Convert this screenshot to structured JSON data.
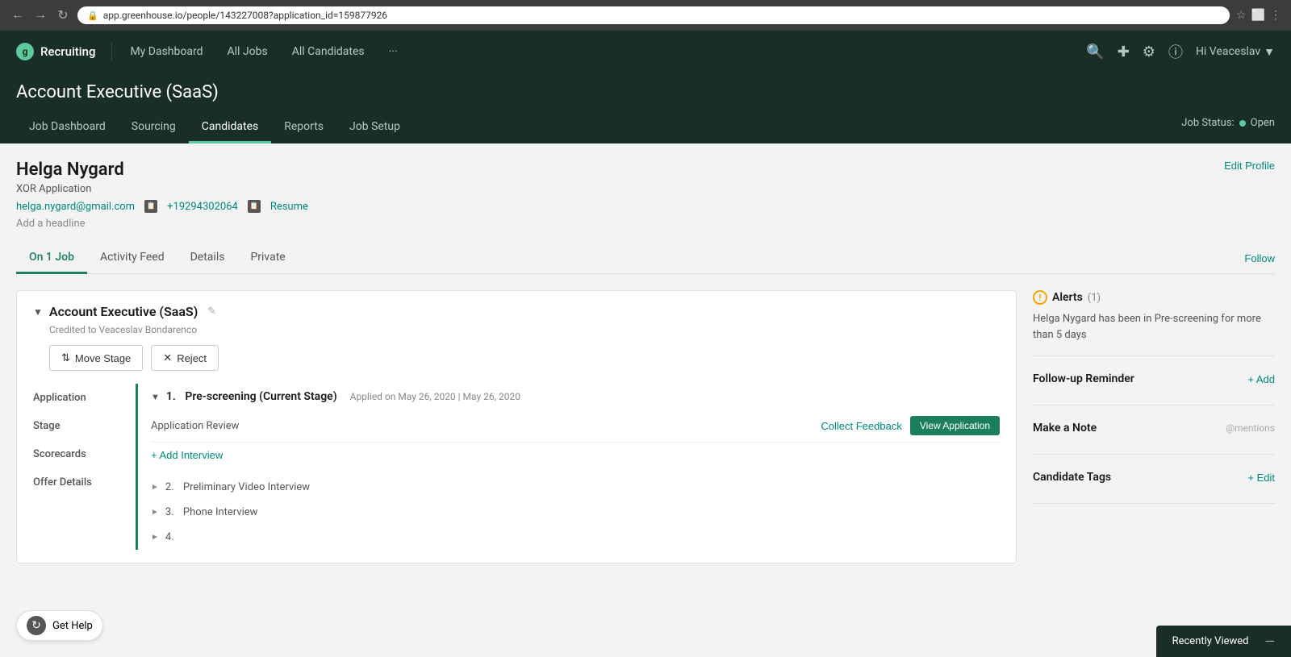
{
  "browser": {
    "url": "app.greenhouse.io/people/143227008?application_id=159877926",
    "back_title": "Back",
    "forward_title": "Forward",
    "refresh_title": "Refresh"
  },
  "app_nav": {
    "logo_text": "g",
    "app_name": "Recruiting",
    "links": [
      "My Dashboard",
      "All Jobs",
      "All Candidates",
      "···"
    ],
    "user_greeting": "Hi Veaceslav",
    "search_icon": "search",
    "add_icon": "plus",
    "settings_icon": "gear",
    "help_icon": "question"
  },
  "job_header": {
    "title": "Account Executive (SaaS)",
    "tabs": [
      "Job Dashboard",
      "Sourcing",
      "Candidates",
      "Reports",
      "Job Setup"
    ],
    "active_tab": "Candidates",
    "status_label": "Job Status:",
    "status_value": "Open"
  },
  "candidate": {
    "name": "Helga Nygard",
    "app_type": "XOR Application",
    "email": "helga.nygard@gmail.com",
    "phone": "+19294302064",
    "resume_label": "Resume",
    "add_headline": "Add a headline",
    "edit_profile_label": "Edit Profile",
    "tabs": [
      "On 1 Job",
      "Activity Feed",
      "Details",
      "Private"
    ],
    "active_tab": "On 1 Job",
    "follow_label": "Follow"
  },
  "application": {
    "job_title": "Account Executive (SaaS)",
    "credited_to": "Credited to Veaceslav Bondarenco",
    "move_stage_label": "Move Stage",
    "reject_label": "Reject",
    "sections": {
      "application_label": "Application",
      "stage_label": "Stage",
      "scorecards_label": "Scorecards",
      "offer_details_label": "Offer Details"
    },
    "stage": {
      "number": "1.",
      "name": "Pre-screening (Current Stage)",
      "applied_date": "Applied on May 26, 2020 | May 26, 2020",
      "application_review_label": "Application Review",
      "collect_feedback_label": "Collect Feedback",
      "view_application_label": "View Application",
      "add_interview_label": "+ Add Interview"
    },
    "other_stages": [
      {
        "number": "2.",
        "name": "Preliminary Video Interview"
      },
      {
        "number": "3.",
        "name": "Phone Interview"
      },
      {
        "number": "4.",
        "name": ""
      }
    ]
  },
  "sidebar": {
    "alerts": {
      "title": "Alerts",
      "count": "(1)",
      "text": "Helga Nygard has been in Pre-screening for more than 5 days"
    },
    "follow_up": {
      "title": "Follow-up Reminder",
      "add_label": "+ Add"
    },
    "make_note": {
      "title": "Make a Note",
      "placeholder": "@mentions"
    },
    "candidate_tags": {
      "title": "Candidate Tags",
      "edit_label": "+ Edit"
    }
  },
  "recently_viewed": {
    "label": "Recently Viewed"
  },
  "get_help": {
    "label": "Get Help"
  }
}
